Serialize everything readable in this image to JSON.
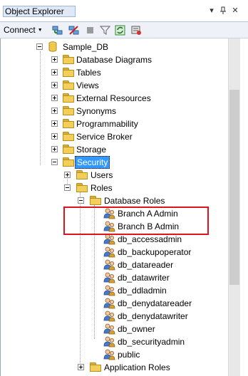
{
  "panel": {
    "title": "Object Explorer",
    "pin_glyph": "▾",
    "autohide_glyph": "ᵩ",
    "close_glyph": "✕"
  },
  "toolbar": {
    "connect_label": "Connect",
    "connect_arrow": "▼"
  },
  "tree": {
    "database": "Sample_DB",
    "db_children": [
      "Database Diagrams",
      "Tables",
      "Views",
      "External Resources",
      "Synonyms",
      "Programmability",
      "Service Broker",
      "Storage"
    ],
    "security": "Security",
    "users": "Users",
    "roles": "Roles",
    "database_roles": "Database Roles",
    "roles_list": [
      "Branch A Admin",
      "Branch B Admin",
      "db_accessadmin",
      "db_backupoperator",
      "db_datareader",
      "db_datawriter",
      "db_ddladmin",
      "db_denydatareader",
      "db_denydatawriter",
      "db_owner",
      "db_securityadmin",
      "public"
    ],
    "application_roles": "Application Roles"
  },
  "highlight": {
    "color": "#e0121b"
  }
}
